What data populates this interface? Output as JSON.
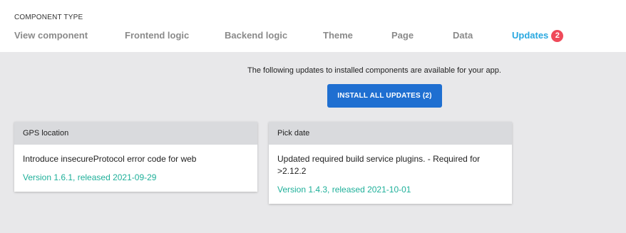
{
  "header": {
    "section_label": "COMPONENT TYPE",
    "tabs": [
      {
        "label": "View component"
      },
      {
        "label": "Frontend logic"
      },
      {
        "label": "Backend logic"
      },
      {
        "label": "Theme"
      },
      {
        "label": "Page"
      },
      {
        "label": "Data"
      },
      {
        "label": "Updates",
        "badge": "2",
        "active": true
      }
    ]
  },
  "colors": {
    "active_tab": "#29a8e0",
    "badge": "#ef4a5a",
    "button": "#1f6fd1",
    "version_text": "#1fb09a",
    "card_header": "#d9dadd",
    "background": "#e8e8ea"
  },
  "main": {
    "message": "The following updates to installed components are available for your app.",
    "install_button": "INSTALL ALL UPDATES (2)",
    "cards": [
      {
        "title": "GPS location",
        "description": "Introduce insecureProtocol error code for web",
        "version": "Version 1.6.1, released 2021-09-29"
      },
      {
        "title": "Pick date",
        "description": "Updated required build service plugins. - Required for >2.12.2",
        "version": "Version 1.4.3, released 2021-10-01"
      }
    ]
  }
}
